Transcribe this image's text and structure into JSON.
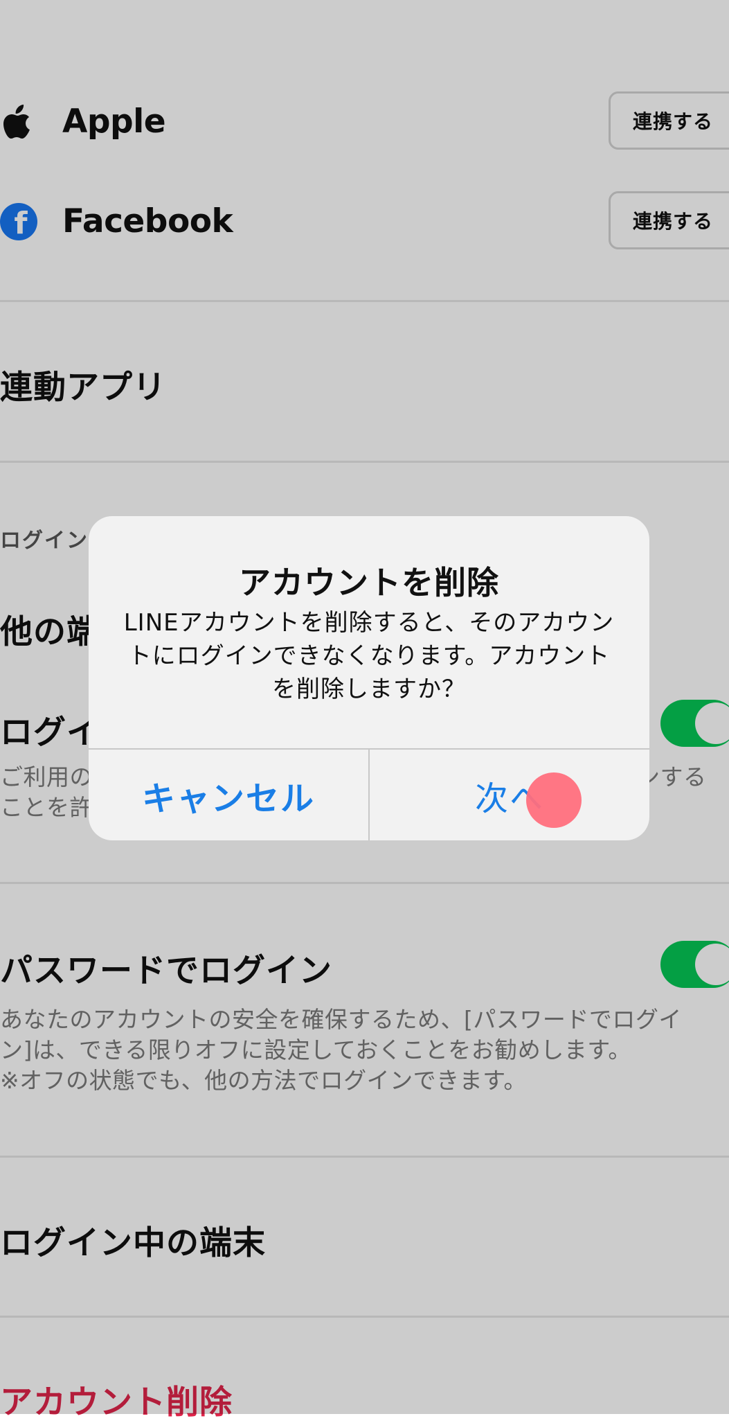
{
  "linked_accounts": [
    {
      "name": "Apple",
      "icon": "apple-icon",
      "button_label": "連携する"
    },
    {
      "name": "Facebook",
      "icon": "facebook-icon",
      "button_label": "連携する"
    }
  ],
  "sections": {
    "linked_apps": "連動アプリ",
    "login_header": "ログイン",
    "other_device_title": "他の端末",
    "login_qr_title": "ログイ",
    "login_qr_desc_line1": "ご利用の",
    "login_qr_desc_line1_tail": "ンする",
    "login_qr_desc_line2": "ことを許",
    "password_login_title": "パスワードでログイン",
    "password_login_desc": [
      "あなたのアカウントの安全を確保するため、[パスワードでログイ",
      "ン]は、できる限りオフに設定しておくことをお勧めします。",
      "※オフの状態でも、他の方法でログインできます。"
    ],
    "logged_in_devices": "ログイン中の端末",
    "delete_account": "アカウント削除"
  },
  "dialog": {
    "title": "アカウントを削除",
    "message": "LINEアカウントを削除すると、そのアカウントにログインできなくなります。アカウントを削除しますか？",
    "cancel_label": "キャンセル",
    "next_label": "次へ"
  },
  "colors": {
    "toggle_on": "#06c755",
    "dialog_button": "#1a7ee6",
    "danger": "#e0254a",
    "touch_indicator": "#ff6f7d"
  }
}
